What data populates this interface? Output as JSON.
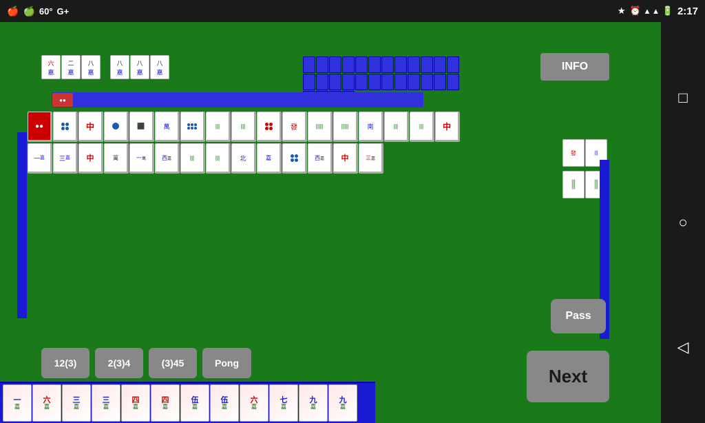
{
  "statusBar": {
    "icons": [
      "🍎",
      "🍏"
    ],
    "temperature": "60°",
    "gplusIcon": "G+",
    "bluetooth": "⚡",
    "alarm": "⏰",
    "wifi": "▲",
    "signal": "▲",
    "battery": "🔋",
    "time": "2:17"
  },
  "buttons": {
    "info": "INFO",
    "action1": "12(3)",
    "action2": "2(3)4",
    "action3": "(3)45",
    "action4": "Pong",
    "pass": "Pass",
    "next": "Next"
  },
  "navIcons": {
    "square": "□",
    "circle": "○",
    "triangle": "◁"
  },
  "game": {
    "topGroupTiles": [
      [
        "六",
        "八",
        "八",
        "嘉"
      ],
      [
        "八",
        "八",
        "八",
        "嘉"
      ],
      [],
      []
    ],
    "playerTiles": [
      "一",
      "六",
      "三",
      "三",
      "四",
      "四",
      "伍",
      "伍",
      "六",
      "七",
      "九",
      "九"
    ]
  }
}
